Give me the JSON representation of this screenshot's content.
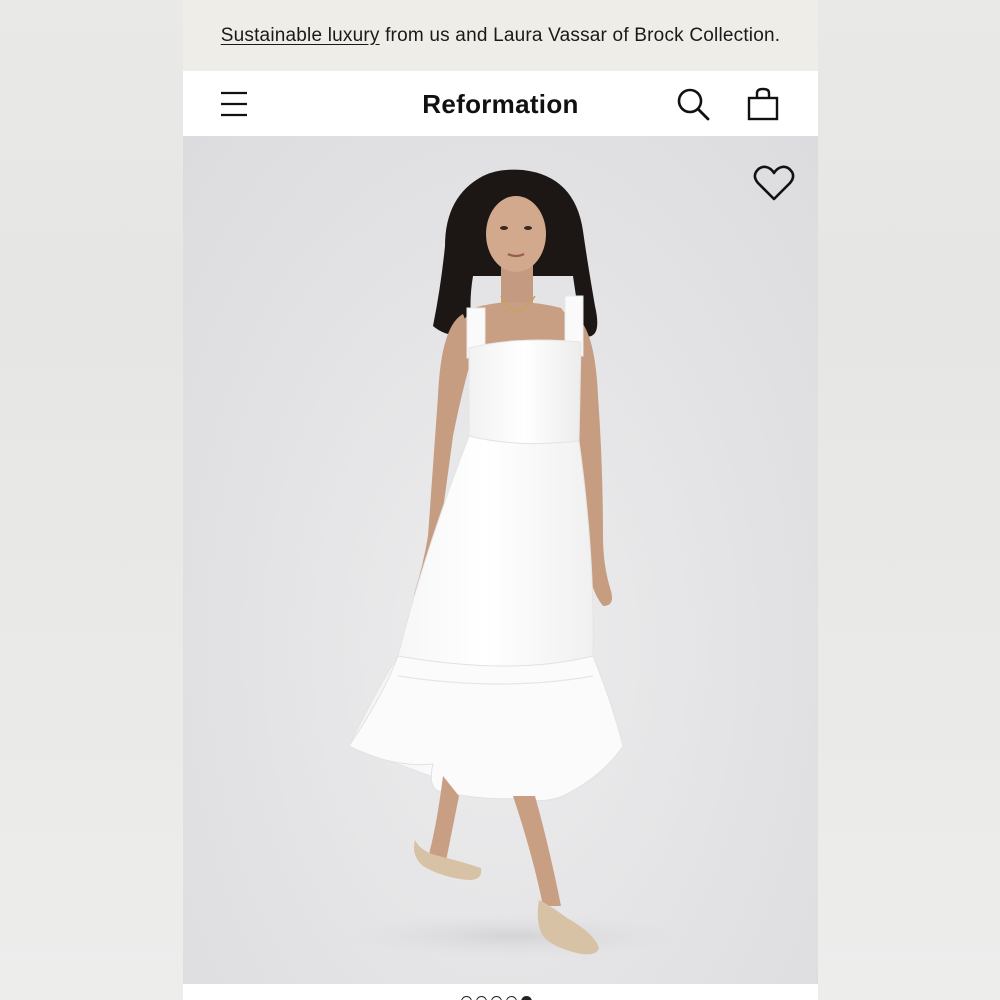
{
  "promo": {
    "link_text": "Sustainable luxury",
    "rest_text": "from us and Laura Vassar of Brock Collection."
  },
  "header": {
    "brand": "Reformation",
    "icons": [
      "menu-icon",
      "search-icon",
      "shopping-bag-icon"
    ]
  },
  "hero": {
    "favorite_icon": "heart-icon",
    "image": "model-in-white-midi-dress"
  },
  "carousel": {
    "total": 5,
    "active_index": 4
  },
  "colors": {
    "promo_bg": "#eeede8",
    "nav_bg": "#ffffff",
    "hero_bg": "#e3e3e5",
    "text": "#111111"
  }
}
